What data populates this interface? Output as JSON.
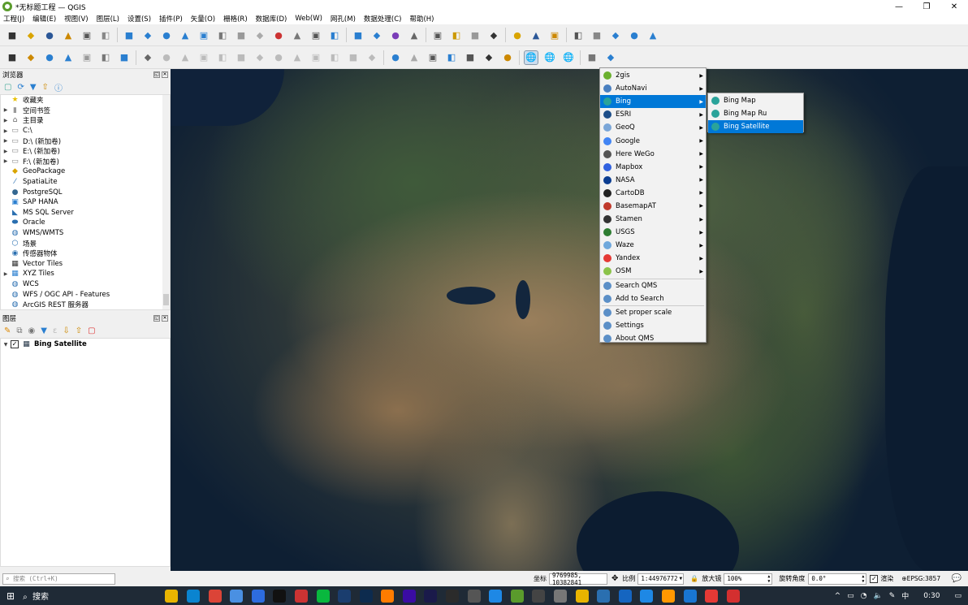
{
  "window": {
    "title": "*无标题工程 — QGIS",
    "min": "—",
    "max": "❐",
    "close": "✕"
  },
  "menu": [
    "工程(J)",
    "编辑(E)",
    "视图(V)",
    "图层(L)",
    "设置(S)",
    "插件(P)",
    "矢量(O)",
    "栅格(R)",
    "数据库(D)",
    "Web(W)",
    "网孔(M)",
    "数据处理(C)",
    "帮助(H)"
  ],
  "browser": {
    "title": "浏览器",
    "items": [
      {
        "label": "收藏夹",
        "arrow": false,
        "icon": "star-icon"
      },
      {
        "label": "空间书签",
        "arrow": true,
        "icon": "bookmark-icon"
      },
      {
        "label": "主目录",
        "arrow": true,
        "icon": "home-folder-icon"
      },
      {
        "label": "C:\\",
        "arrow": true,
        "icon": "folder-icon"
      },
      {
        "label": "D:\\ (新加卷)",
        "arrow": true,
        "icon": "folder-icon"
      },
      {
        "label": "E:\\ (新加卷)",
        "arrow": true,
        "icon": "folder-icon"
      },
      {
        "label": "F:\\ (新加卷)",
        "arrow": true,
        "icon": "folder-icon"
      },
      {
        "label": "GeoPackage",
        "arrow": false,
        "icon": "geopackage-icon"
      },
      {
        "label": "SpatiaLite",
        "arrow": false,
        "icon": "spatialite-icon"
      },
      {
        "label": "PostgreSQL",
        "arrow": false,
        "icon": "postgresql-icon"
      },
      {
        "label": "SAP HANA",
        "arrow": false,
        "icon": "sap-hana-icon"
      },
      {
        "label": "MS SQL Server",
        "arrow": false,
        "icon": "mssql-icon"
      },
      {
        "label": "Oracle",
        "arrow": false,
        "icon": "oracle-icon"
      },
      {
        "label": "WMS/WMTS",
        "arrow": false,
        "icon": "wms-icon"
      },
      {
        "label": "场景",
        "arrow": false,
        "icon": "scene-icon"
      },
      {
        "label": "传感器物体",
        "arrow": false,
        "icon": "sensor-icon"
      },
      {
        "label": "Vector Tiles",
        "arrow": false,
        "icon": "vector-tiles-icon"
      },
      {
        "label": "XYZ Tiles",
        "arrow": true,
        "icon": "xyz-tiles-icon"
      },
      {
        "label": "WCS",
        "arrow": false,
        "icon": "wcs-icon"
      },
      {
        "label": "WFS / OGC API - Features",
        "arrow": false,
        "icon": "wfs-icon"
      },
      {
        "label": "ArcGIS REST 服务器",
        "arrow": false,
        "icon": "arcgis-icon"
      }
    ]
  },
  "layers": {
    "title": "图层",
    "items": [
      {
        "label": "Bing Satellite",
        "checked": true
      }
    ]
  },
  "qms_menu": {
    "providers": [
      {
        "label": "2gis",
        "color": "#6ab02e"
      },
      {
        "label": "AutoNavi",
        "color": "#4a7fc0"
      },
      {
        "label": "Bing",
        "color": "#2aa39a"
      },
      {
        "label": "ESRI",
        "color": "#1d4e89"
      },
      {
        "label": "GeoQ",
        "color": "#7aa6d8"
      },
      {
        "label": "Google",
        "color": "#4285f4"
      },
      {
        "label": "Here WeGo",
        "color": "#555555"
      },
      {
        "label": "Mapbox",
        "color": "#3061e0"
      },
      {
        "label": "NASA",
        "color": "#0b3d91"
      },
      {
        "label": "CartoDB",
        "color": "#222222"
      },
      {
        "label": "BasemapAT",
        "color": "#c0392b"
      },
      {
        "label": "Stamen",
        "color": "#333333"
      },
      {
        "label": "USGS",
        "color": "#2e7d32"
      },
      {
        "label": "Waze",
        "color": "#6fa8dc"
      },
      {
        "label": "Yandex",
        "color": "#e53935"
      },
      {
        "label": "OSM",
        "color": "#8bc34a"
      }
    ],
    "actions": [
      "Search QMS",
      "Add to Search"
    ],
    "settings": [
      "Set proper scale",
      "Settings",
      "About QMS"
    ],
    "selected": "Bing"
  },
  "bing_submenu": {
    "items": [
      "Bing Map",
      "Bing Map Ru",
      "Bing Satellite"
    ],
    "selected": "Bing Satellite"
  },
  "status": {
    "search_placeholder": "搜索 (Ctrl+K)",
    "coord_label": "坐标",
    "coord": "9769985, 10382841",
    "scale_label": "比例",
    "scale": "1:44976772",
    "magnifier_label": "放大镜",
    "magnifier": "100%",
    "rotation_label": "旋转角度",
    "rotation": "0.0°",
    "render_label": "渲染",
    "crs": "EPSG:3857"
  },
  "taskbar": {
    "search": "搜索",
    "ime": "中",
    "time": "0:30"
  }
}
